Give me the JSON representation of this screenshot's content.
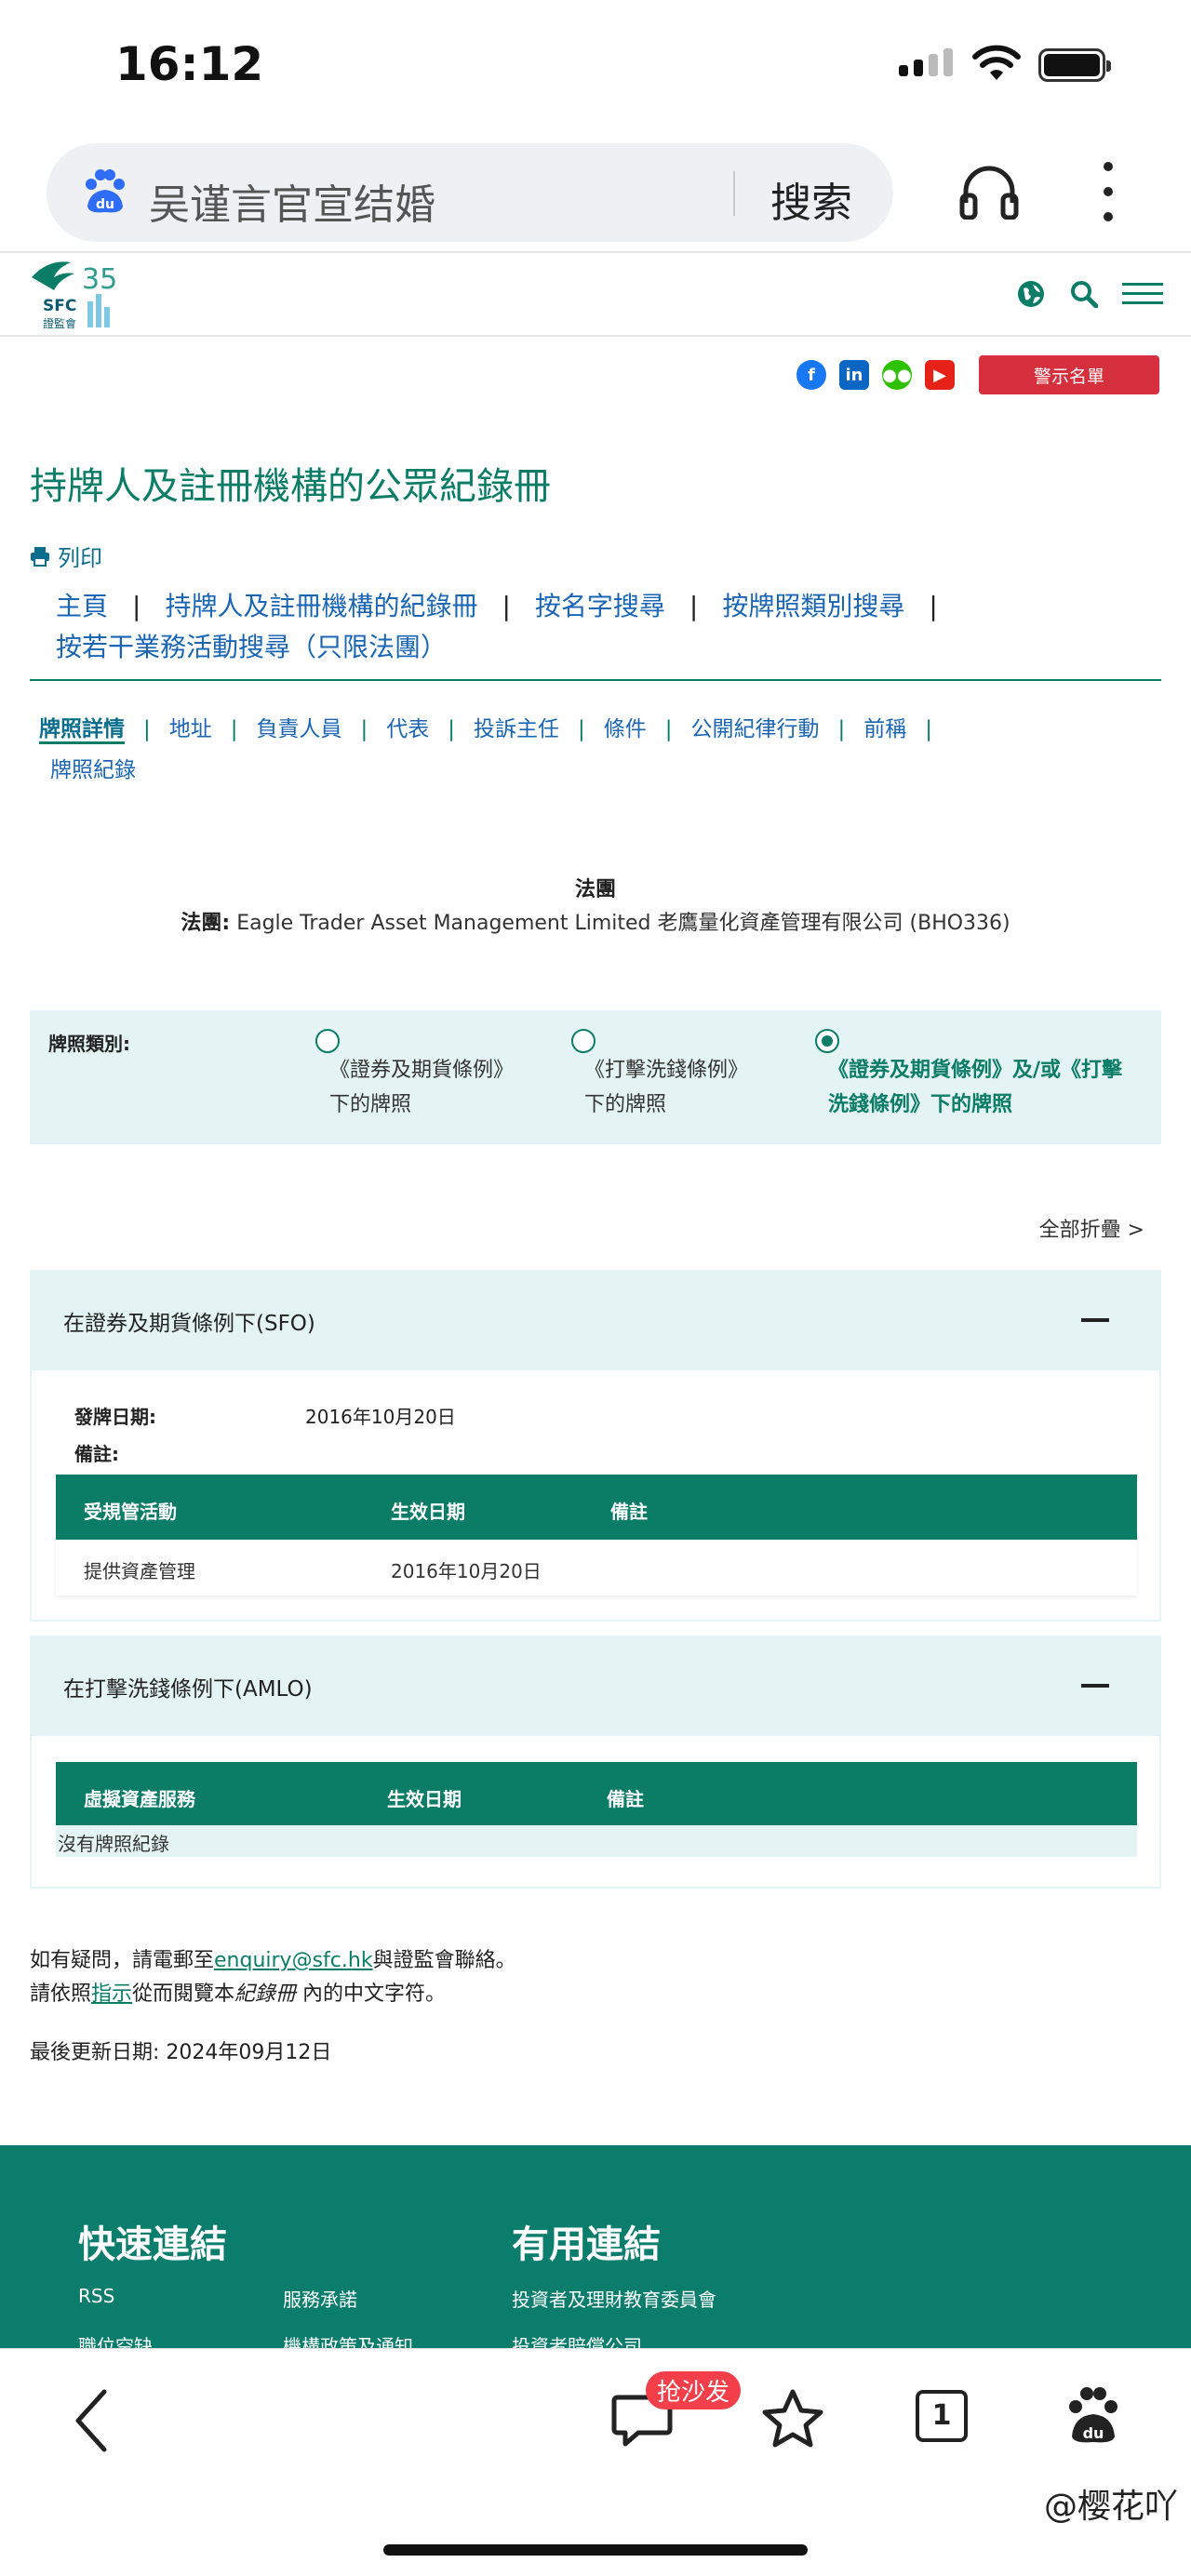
{
  "status_bar": {
    "time": "16:12"
  },
  "browser": {
    "query": "吴谨言官宣结婚",
    "search_button": "搜索"
  },
  "site": {
    "logo_text": "SFC",
    "logo_sub": "證監會",
    "logo_num": "35",
    "warning_button": "警示名單",
    "social": [
      "facebook-icon",
      "linkedin-icon",
      "wechat-icon",
      "youtube-icon"
    ]
  },
  "page": {
    "title": "持牌人及註冊機構的公眾紀錄冊",
    "print_label": "列印",
    "breadcrumbs": [
      "主頁",
      "持牌人及註冊機構的紀錄冊",
      "按名字搜尋",
      "按牌照類別搜尋",
      "按若干業務活動搜尋（只限法團）"
    ],
    "tabs": [
      "牌照詳情",
      "地址",
      "負責人員",
      "代表",
      "投訴主任",
      "條件",
      "公開紀律行動",
      "前稱",
      "牌照紀錄"
    ],
    "entity_type": "法團",
    "entity_label": "法團:",
    "entity_name": "Eagle Trader Asset Management Limited 老鷹量化資產管理有限公司 (BHO336)",
    "license_type_label": "牌照類別:",
    "license_options": [
      {
        "line1": "《證券及期貨條例》",
        "line2": "下的牌照",
        "selected": false
      },
      {
        "line1": "《打擊洗錢條例》",
        "line2": "下的牌照",
        "selected": false
      },
      {
        "line1": "《證券及期貨條例》及/或《打擊",
        "line2": "洗錢條例》下的牌照",
        "selected": true
      }
    ],
    "collapse_all": "全部折疊 >"
  },
  "sfo": {
    "title": "在證券及期貨條例下(SFO)",
    "issue_date_label": "發牌日期:",
    "issue_date": "2016年10月20日",
    "remarks_label": "備註:",
    "columns": [
      "受規管活動",
      "生效日期",
      "備註"
    ],
    "rows": [
      {
        "activity": "提供資產管理",
        "date": "2016年10月20日",
        "remark": ""
      }
    ]
  },
  "amlo": {
    "title": "在打擊洗錢條例下(AMLO)",
    "columns": [
      "虛擬資產服務",
      "生效日期",
      "備註"
    ],
    "no_record": "沒有牌照紀錄"
  },
  "contact": {
    "line1_pre": "如有疑問，請電郵至",
    "email": "enquiry@sfc.hk",
    "line1_post": "與證監會聯絡。",
    "line2_pre": "請依照",
    "line2_link": "指示",
    "line2_mid": "從而閱覽本",
    "line2_italic": "紀錄冊",
    "line2_post": " 內的中文字符。",
    "updated": "最後更新日期: 2024年09月12日"
  },
  "footer": {
    "quick_links_title": "快速連結",
    "useful_links_title": "有用連結",
    "quick_links": [
      "RSS",
      "服務承諾",
      "職位空缺",
      "機構政策及通知"
    ],
    "useful_links": [
      "投資者及理財教育委員會",
      "投資者賠償公司"
    ]
  },
  "bottom_nav": {
    "badge": "抢沙发",
    "tab_count": "1",
    "watermark": "@樱花吖"
  },
  "colors": {
    "brand_green": "#0b7d67",
    "warning_red": "#d6303e",
    "link_blue": "#1a66b5"
  }
}
